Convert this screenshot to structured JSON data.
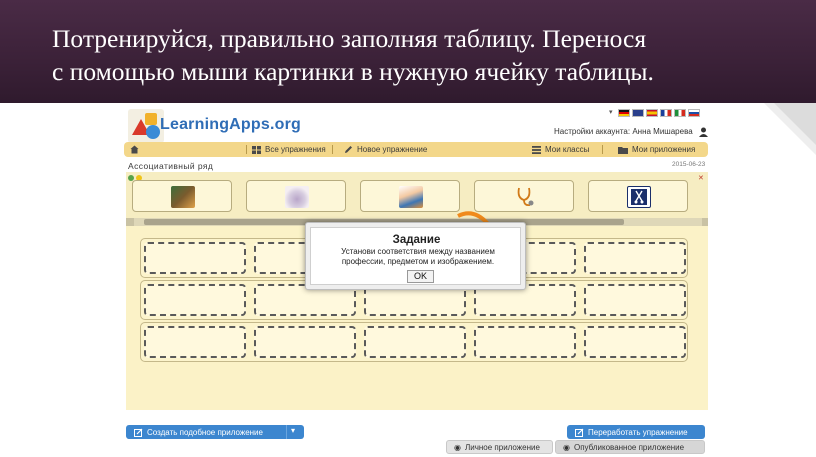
{
  "slide": {
    "title_line1": "Потренируйся, правильно заполняя таблицу. Перенося",
    "title_line2": "с помощью мыши картинки в нужную ячейку таблицы."
  },
  "app": {
    "logo": "LearningApps.org",
    "account_label": "Настройки аккаунта: Анна Мишарева",
    "nav": {
      "all_exercises": "Все упражнения",
      "new_exercise": "Новое упражнение",
      "my_classes": "Мои классы",
      "my_apps": "Мои приложения"
    },
    "exercise_title": "Ассоциативный ряд",
    "date": "2015-06-23",
    "picture_cards": [
      "teacher-picture",
      "cake-picture",
      "cook-picture",
      "stethoscope-picture",
      "sewing-picture"
    ],
    "modal": {
      "title": "Задание",
      "text": "Установи соответствия между названием профессии, предметом и изображением.",
      "ok": "OK"
    },
    "bottom": {
      "create_similar": "Создать подобное приложение",
      "rework": "Переработать упражнение",
      "private_app": "Личное приложение",
      "published_app": "Опубликованное приложение"
    }
  },
  "colors": {
    "header_bg": "#3b2138",
    "nav_bg": "#f3d78a",
    "canvas_bg": "#fbf2c7",
    "button_blue": "#3c86cf",
    "logo_blue": "#2f6db6"
  }
}
